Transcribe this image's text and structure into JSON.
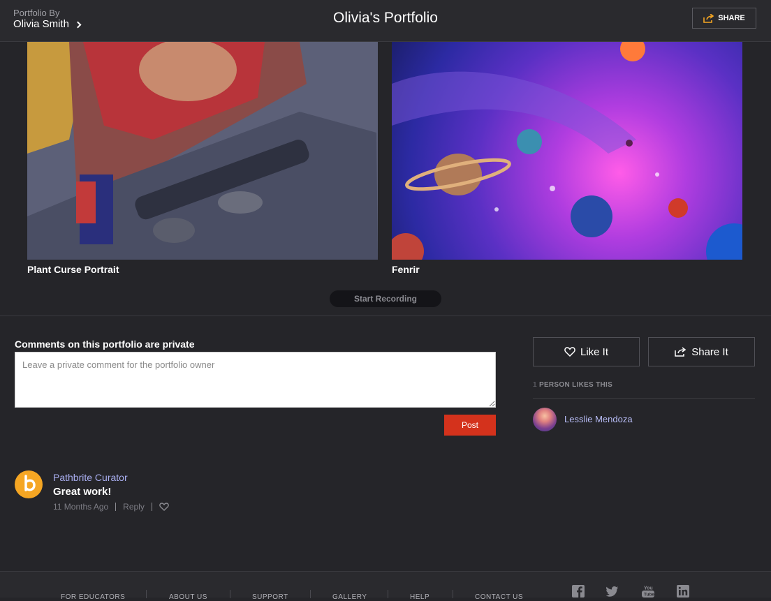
{
  "header": {
    "owner_label": "Portfolio By",
    "owner_name": "Olivia Smith",
    "title": "Olivia's Portfolio",
    "share_label": "SHARE"
  },
  "gallery": {
    "items": [
      {
        "title": "Plant Curse Portrait"
      },
      {
        "title": "Fenrir"
      }
    ],
    "record_label": "Start Recording"
  },
  "comments": {
    "heading": "Comments on this portfolio are private",
    "placeholder": "Leave a private comment for the portfolio owner",
    "post_label": "Post",
    "items": [
      {
        "author": "Pathbrite Curator",
        "text": "Great work!",
        "time": "11 Months Ago",
        "reply_label": "Reply"
      }
    ]
  },
  "likes": {
    "like_label": "Like It",
    "share_label": "Share It",
    "count": "1",
    "count_text": "PERSON LIKES THIS",
    "likers": [
      {
        "name": "Lesslie Mendoza"
      }
    ]
  },
  "footer": {
    "nav": [
      "FOR EDUCATORS",
      "ABOUT US",
      "SUPPORT",
      "GALLERY",
      "HELP",
      "CONTACT US"
    ],
    "social": [
      "facebook-icon",
      "twitter-icon",
      "youtube-icon",
      "linkedin-icon"
    ]
  },
  "colors": {
    "background": "#252529",
    "accent_orange": "#f5a623",
    "post_red": "#d4321c",
    "link_blue": "#a9aef0"
  }
}
